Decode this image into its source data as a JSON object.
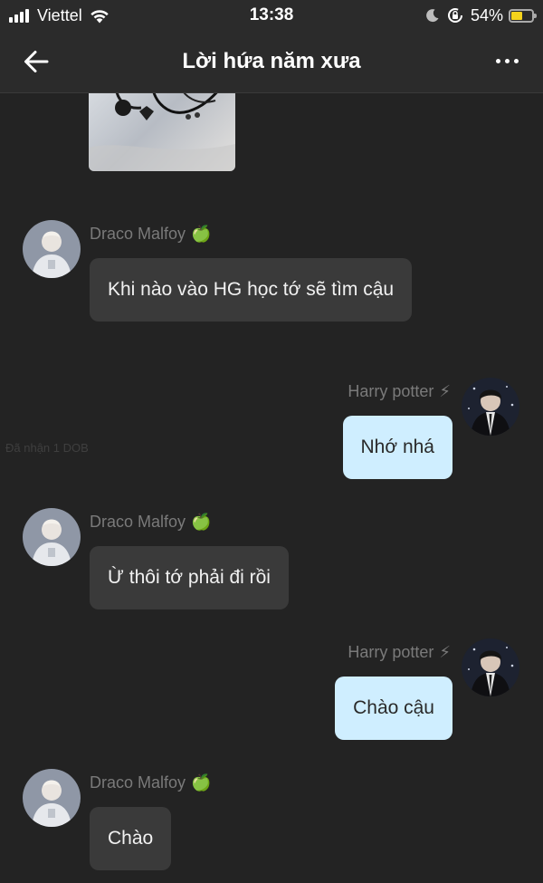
{
  "status_bar": {
    "carrier": "Viettel",
    "time": "13:38",
    "battery_percent": "54%",
    "battery_level": 0.54,
    "icons": [
      "signal-icon",
      "wifi-icon",
      "moon-icon",
      "rotation-lock-icon",
      "battery-icon"
    ]
  },
  "header": {
    "title": "Lời hứa năm xưa",
    "back_icon": "back-arrow-icon",
    "more_icon": "more-icon"
  },
  "colors": {
    "background": "#232323",
    "bar": "#2b2b2b",
    "incoming_bubble": "#3a3a3a",
    "outgoing_bubble": "#cfeeff",
    "name_text": "#7a7a7a"
  },
  "messages": [
    {
      "side": "left",
      "sender": "Draco Malfoy",
      "emoji": "🍏",
      "text": "Khi nào vào HG học tớ sẽ tìm cậu"
    },
    {
      "side": "right",
      "sender": "Harry potter",
      "emoji": "⚡",
      "text": "Nhớ nhá"
    },
    {
      "side": "left",
      "sender": "Draco Malfoy",
      "emoji": "🍏",
      "text": "Ừ thôi tớ phải đi rồi"
    },
    {
      "side": "right",
      "sender": "Harry potter",
      "emoji": "⚡",
      "text": "Chào cậu"
    },
    {
      "side": "left",
      "sender": "Draco Malfoy",
      "emoji": "🍏",
      "text": "Chào"
    }
  ],
  "faint_timestamp": "Đã nhận 1 DOB"
}
